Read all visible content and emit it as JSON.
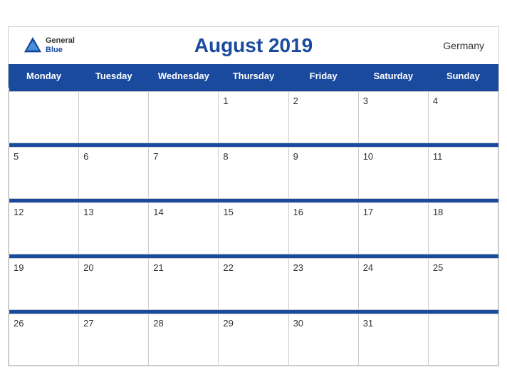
{
  "header": {
    "title": "August 2019",
    "country": "Germany",
    "logo_general": "General",
    "logo_blue": "Blue"
  },
  "days_of_week": [
    "Monday",
    "Tuesday",
    "Wednesday",
    "Thursday",
    "Friday",
    "Saturday",
    "Sunday"
  ],
  "weeks": [
    [
      {
        "day": "",
        "empty": true
      },
      {
        "day": "",
        "empty": true
      },
      {
        "day": "",
        "empty": true
      },
      {
        "day": "1"
      },
      {
        "day": "2"
      },
      {
        "day": "3"
      },
      {
        "day": "4"
      }
    ],
    [
      {
        "day": "5"
      },
      {
        "day": "6"
      },
      {
        "day": "7"
      },
      {
        "day": "8"
      },
      {
        "day": "9"
      },
      {
        "day": "10"
      },
      {
        "day": "11"
      }
    ],
    [
      {
        "day": "12"
      },
      {
        "day": "13"
      },
      {
        "day": "14"
      },
      {
        "day": "15"
      },
      {
        "day": "16"
      },
      {
        "day": "17"
      },
      {
        "day": "18"
      }
    ],
    [
      {
        "day": "19"
      },
      {
        "day": "20"
      },
      {
        "day": "21"
      },
      {
        "day": "22"
      },
      {
        "day": "23"
      },
      {
        "day": "24"
      },
      {
        "day": "25"
      }
    ],
    [
      {
        "day": "26"
      },
      {
        "day": "27"
      },
      {
        "day": "28"
      },
      {
        "day": "29"
      },
      {
        "day": "30"
      },
      {
        "day": "31"
      },
      {
        "day": "",
        "empty": true
      }
    ]
  ],
  "colors": {
    "header_bg": "#1a4a9e",
    "row_stripe": "#eef2fb"
  }
}
